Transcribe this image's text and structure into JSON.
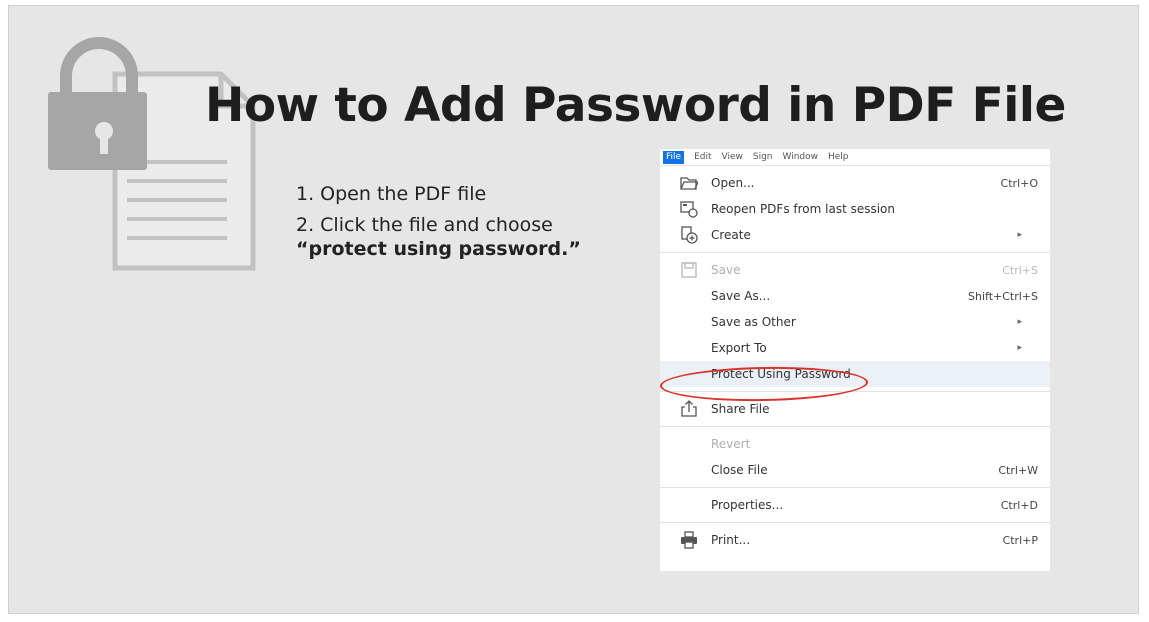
{
  "slide": {
    "title": "How to Add Password in PDF File",
    "steps": [
      "1. Open the PDF file",
      "2. Click the file and choose"
    ],
    "emphasis": "“protect using password.”"
  },
  "menubar": [
    "File",
    "Edit",
    "View",
    "Sign",
    "Window",
    "Help"
  ],
  "file_menu": [
    {
      "label": "Open...",
      "shortcut": "Ctrl+O",
      "icon": "folder-icon"
    },
    {
      "label": "Reopen PDFs from last session",
      "shortcut": "",
      "icon": "reopen-icon"
    },
    {
      "label": "Create",
      "shortcut": "",
      "icon": "create-icon",
      "submenu": true
    },
    {
      "label": "Save",
      "shortcut": "Ctrl+S",
      "icon": "save-icon",
      "disabled": true
    },
    {
      "label": "Save As...",
      "shortcut": "Shift+Ctrl+S"
    },
    {
      "label": "Save as Other",
      "shortcut": "",
      "submenu": true
    },
    {
      "label": "Export To",
      "shortcut": "",
      "submenu": true
    },
    {
      "label": "Protect Using Password",
      "shortcut": "",
      "highlighted": true
    },
    {
      "label": "Share File",
      "shortcut": "",
      "icon": "share-icon"
    },
    {
      "label": "Revert",
      "shortcut": "",
      "disabled": true
    },
    {
      "label": "Close File",
      "shortcut": "Ctrl+W"
    },
    {
      "label": "Properties...",
      "shortcut": "Ctrl+D"
    },
    {
      "label": "Print...",
      "shortcut": "Ctrl+P",
      "icon": "printer-icon"
    }
  ],
  "colors": {
    "accent": "#1473e6",
    "annotation": "#d8342b",
    "highlight": "#eaf0f6",
    "slide_bg": "#e6e6e6"
  }
}
